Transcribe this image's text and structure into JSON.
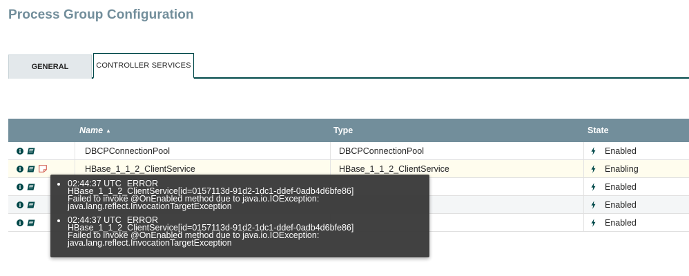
{
  "page": {
    "title": "Process Group Configuration"
  },
  "tabs": [
    {
      "label": "GENERAL",
      "active": false
    },
    {
      "label": "CONTROLLER SERVICES",
      "active": true
    }
  ],
  "table": {
    "columns": {
      "name": "Name",
      "type": "Type",
      "state": "State"
    },
    "sort_indicator": "▲",
    "rows": [
      {
        "name": "DBCPConnectionPool",
        "type": "DBCPConnectionPool",
        "state": "Enabled",
        "has_bulletin": false
      },
      {
        "name": "HBase_1_1_2_ClientService",
        "type": "HBase_1_1_2_ClientService",
        "state": "Enabling",
        "has_bulletin": true
      },
      {
        "name": "",
        "type": "",
        "state": "Enabled",
        "has_bulletin": false
      },
      {
        "name": "",
        "type": "",
        "state": "Enabled",
        "has_bulletin": false
      },
      {
        "name": "",
        "type": "",
        "state": "Enabled",
        "has_bulletin": false
      }
    ]
  },
  "tooltip": {
    "bulletins": [
      {
        "time": "02:44:37 UTC",
        "level": "ERROR",
        "source": "HBase_1_1_2_ClientService[id=0157113d-91d2-1dc1-ddef-0adb4d6bfe86]",
        "message_1": "Failed to invoke @OnEnabled method due to java.io.IOException:",
        "message_2": "java.lang.reflect.InvocationTargetException"
      },
      {
        "time": "02:44:37 UTC",
        "level": "ERROR",
        "source": "HBase_1_1_2_ClientService[id=0157113d-91d2-1dc1-ddef-0adb4d6bfe86]",
        "message_1": "Failed to invoke @OnEnabled method due to java.io.IOException:",
        "message_2": "java.lang.reflect.InvocationTargetException"
      }
    ]
  },
  "icons": {
    "info": "info-icon",
    "docs": "book-icon",
    "bulletin": "bulletin-icon",
    "state": "lightning-icon"
  },
  "colors": {
    "header": "#728e9b",
    "accent": "#004849",
    "bulletin": "#d66a5b",
    "tooltip_bg": "#3b3b3b"
  }
}
